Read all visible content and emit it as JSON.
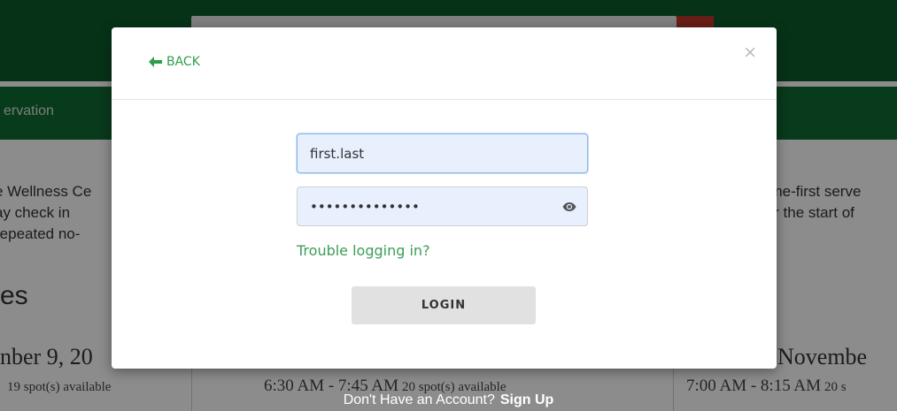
{
  "background": {
    "subnav_text": "ervation",
    "left_paragraph": "e Wellness Ce\nay check in\nrepeated no-",
    "right_paragraph": "ome-first serve\nter the start of",
    "section_heading": "es",
    "date_left": "nber 9, 20",
    "date_right": "Novembe",
    "slot_left_time": "",
    "slot_left_spots": "19 spot(s) available",
    "slot_mid_time": "6:30 AM - 7:45 AM",
    "slot_mid_spots": "20 spot(s) available",
    "slot_right_time": "7:00 AM - 8:15 AM",
    "slot_right_spots": "20 s",
    "signup_prompt": "Don't Have an Account?",
    "signup_link": "Sign Up"
  },
  "modal": {
    "back_label": "BACK",
    "close_symbol": "×",
    "username_value": "first.last",
    "password_value": "••••••••••••••",
    "trouble_link": "Trouble logging in?",
    "login_label": "LOGIN"
  },
  "colors": {
    "accent_green": "#2e9e4c",
    "header_green": "#0b5d2c"
  }
}
